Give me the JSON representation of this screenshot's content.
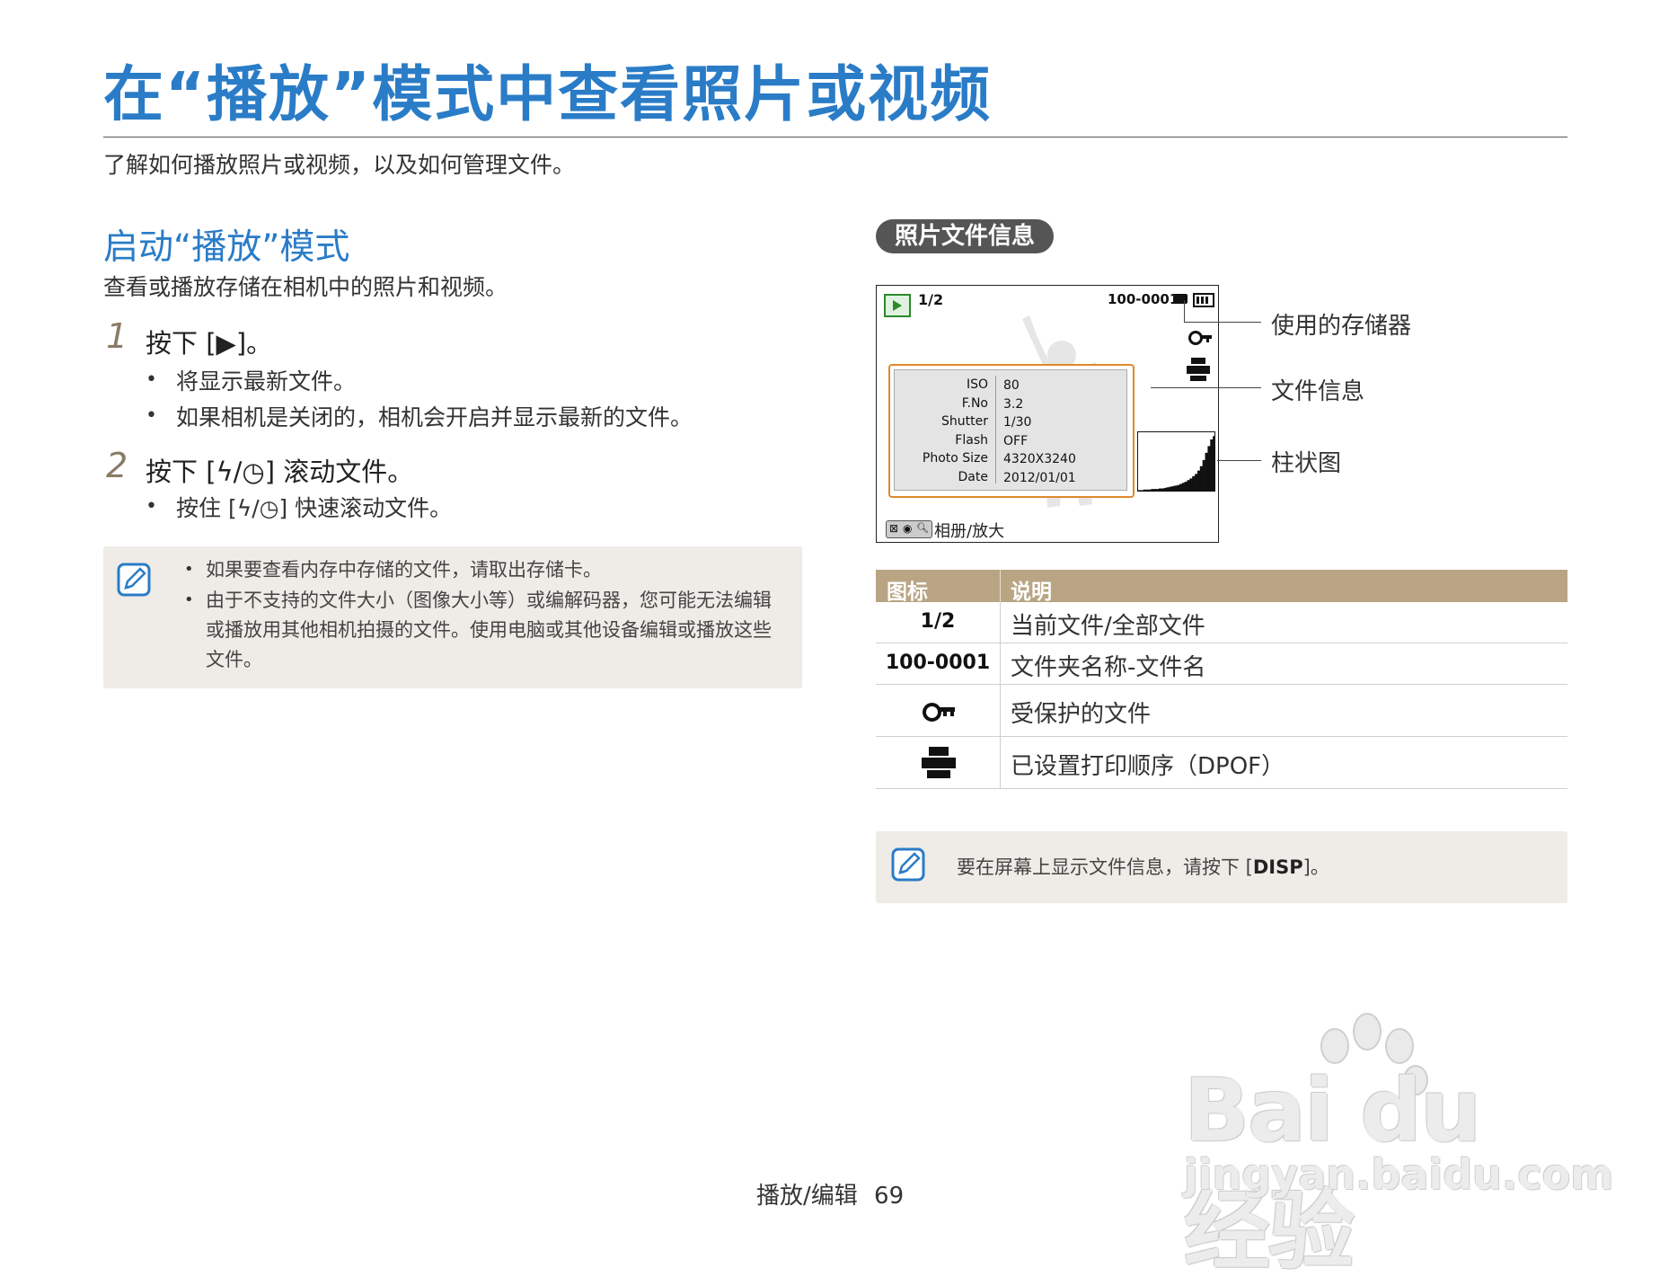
{
  "page": {
    "title": "在“播放”模式中查看照片或视频",
    "subtitle": "了解如何播放照片或视频，以及如何管理文件。"
  },
  "section": {
    "title": "启动“播放”模式",
    "desc": "查看或播放存储在相机中的照片和视频。",
    "steps": [
      {
        "num": "1",
        "text": "按下 [▶]。",
        "bullets": [
          "将显示最新文件。",
          "如果相机是关闭的，相机会开启并显示最新的文件。"
        ]
      },
      {
        "num": "2",
        "text": "按下 [ϟ/◷] 滚动文件。",
        "bullets": [
          "按住 [ϟ/◷] 快速滚动文件。"
        ]
      }
    ],
    "note": {
      "items": [
        "如果要查看内存中存储的文件，请取出存储卡。",
        "由于不支持的文件大小（图像大小等）或编解码器，您可能无法编辑或播放用其他相机拍摄的文件。使用电脑或其他设备编辑或播放这些文件。"
      ]
    }
  },
  "fileinfo": {
    "pill": "照片文件信息",
    "screen": {
      "counter": "1/2",
      "filename": "100-0001",
      "info_keys": [
        "ISO",
        "F.No",
        "Shutter",
        "Flash",
        "Photo Size",
        "Date"
      ],
      "info_vals": [
        "80",
        "3.2",
        "1/30",
        "OFF",
        "4320X3240",
        "2012/01/01"
      ],
      "bottom": "相册/放大",
      "histogram": [
        1,
        1,
        2,
        2,
        2,
        3,
        3,
        3,
        4,
        4,
        5,
        6,
        7,
        8,
        9,
        10,
        12,
        14,
        16,
        19,
        22,
        26,
        30,
        36,
        44,
        55,
        68,
        80,
        92,
        98
      ]
    },
    "callouts": [
      "使用的存储器",
      "文件信息",
      "柱状图"
    ],
    "table": {
      "headers": [
        "图标",
        "说明"
      ],
      "rows": [
        {
          "icon": "1/2",
          "desc": "当前文件/全部文件"
        },
        {
          "icon": "100-0001",
          "desc": "文件夹名称-文件名"
        },
        {
          "icon": "",
          "desc": "受保护的文件"
        },
        {
          "icon": "",
          "desc": "已设置打印顺序（DPOF）"
        }
      ]
    },
    "note": {
      "text_before": "要在屏幕上显示文件信息，请按下 [",
      "key": "DISP",
      "text_after": "]。"
    }
  },
  "footer": {
    "section": "播放/编辑",
    "page_num": "69"
  },
  "watermark": {
    "logo": "Bai du 经验",
    "url": "jingyan.baidu.com"
  }
}
